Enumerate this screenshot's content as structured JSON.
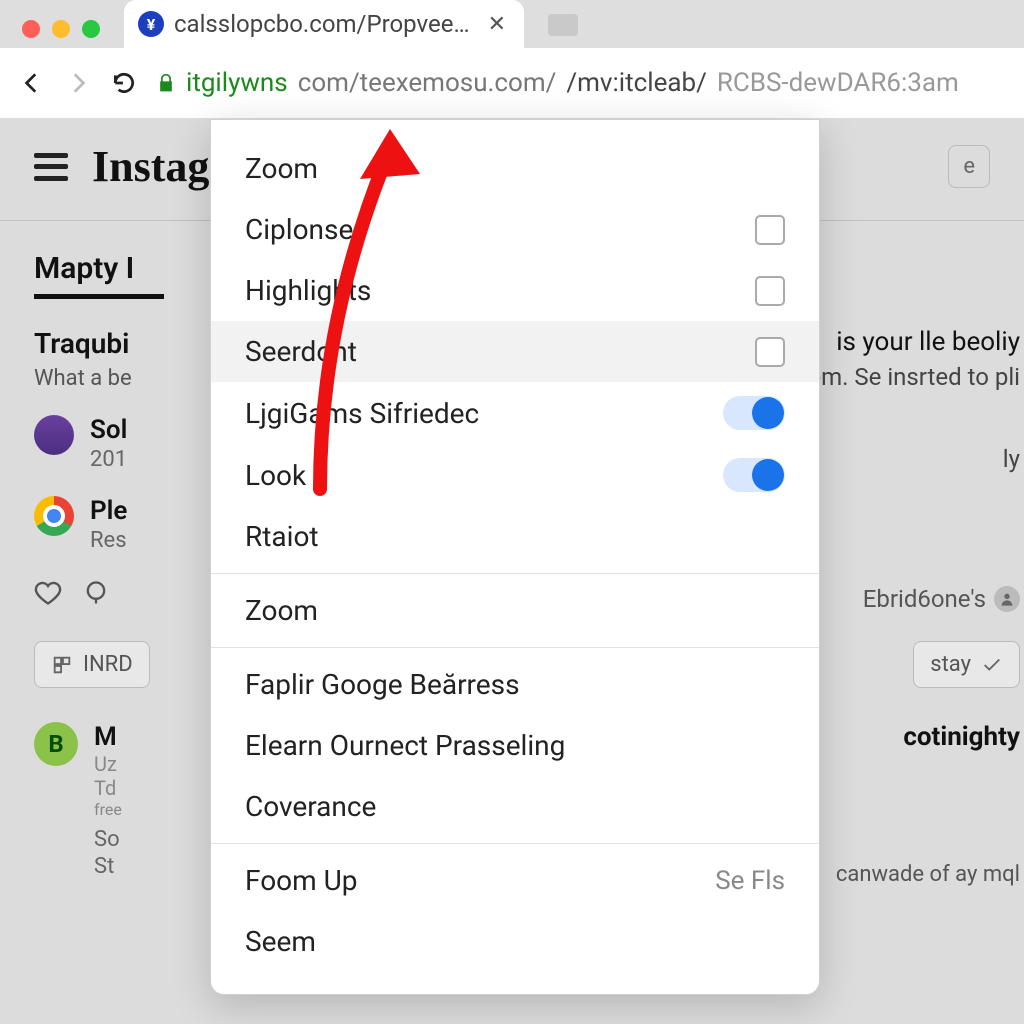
{
  "browser": {
    "tab": {
      "title": "calsslopcbo.com/Propveers"
    },
    "address": {
      "seg1": "itgilywns",
      "seg2": " com/teexemosu.com/",
      "seg3": "/mv:itcleab/",
      "seg4": "RCBS-dewDAR6:3am"
    }
  },
  "page": {
    "brand": "Instag",
    "pill": "e",
    "section": "Mapty I",
    "heading": "Traqubi",
    "heading_sub": "What a be",
    "post1_title": "Sol",
    "post1_sub": "201",
    "post2_title": "Ple",
    "post2_sub": "Res",
    "chip1": "INRD",
    "right_line1": "is your lle beoliy",
    "right_line2": "em. Se insrted to pli",
    "right_line3": "ly",
    "right_badge": "Ebrid6one's",
    "chip_right": "stay",
    "post3_initial": "B",
    "post3_title": "M",
    "post3_line1": "Uz",
    "post3_line2": "Td",
    "post3_line3": "free",
    "post3_line4": "So",
    "post3_line5": "St",
    "tag_right": "cotinighty",
    "bottom_line": "canwade of ay mql"
  },
  "menu": {
    "items": [
      {
        "label": "Zoom",
        "control": null
      },
      {
        "label": "Ciplonse",
        "control": "checkbox"
      },
      {
        "label": "Highlights",
        "control": "checkbox"
      },
      {
        "label": "Seerdont",
        "control": "checkbox",
        "hover": true
      },
      {
        "label": "LjgiGams Sifriedec",
        "control": "toggle"
      },
      {
        "label": "Look",
        "control": "toggle"
      },
      {
        "label": "Rtaiot",
        "control": null
      },
      {
        "label": "Zoom",
        "control": null,
        "sep_before": true
      },
      {
        "label": "Faplir Googe Beărress",
        "control": null,
        "sep_before": true
      },
      {
        "label": "Elearn Ournect Prasseling",
        "control": null
      },
      {
        "label": "Coverance",
        "control": null
      },
      {
        "label": "Foom Up",
        "right": "Se Fls",
        "sep_before": true
      },
      {
        "label": "Seem",
        "control": null
      }
    ]
  }
}
